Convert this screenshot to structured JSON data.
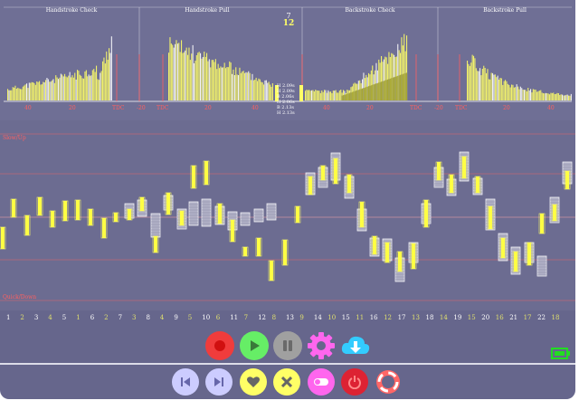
{
  "sections": [
    {
      "label": "Handstroke Check"
    },
    {
      "label": "Handstroke Pull"
    },
    {
      "label": "Backstroke Check"
    },
    {
      "label": "Backstroke Pull"
    }
  ],
  "counter": {
    "top": "7",
    "bottom": "12"
  },
  "mid_panel": {
    "lines": [
      "H 2.09s",
      "H 2.09s",
      "B 2.06s",
      "H 2.06s",
      "B 2.13s",
      "H 2.13s"
    ]
  },
  "axis_ticks": {
    "hs_check": [
      "40",
      "20",
      "TDC"
    ],
    "hs_pull": [
      "-20",
      "TDC",
      "20",
      "40"
    ],
    "bs_check": [
      "40",
      "20",
      "TDC"
    ],
    "bs_pull": [
      "-20",
      "TDC",
      "20",
      "40"
    ]
  },
  "graph_labels": {
    "slow": "Slow/Up",
    "quick": "Quick/Down"
  },
  "bells": [
    "1",
    "2",
    "3",
    "4",
    "5",
    "1",
    "6",
    "2",
    "7",
    "3",
    "8",
    "4",
    "9",
    "5",
    "10",
    "6",
    "11",
    "7",
    "12",
    "8",
    "13",
    "9",
    "14",
    "10",
    "15",
    "11",
    "16",
    "12",
    "17",
    "13",
    "18",
    "14",
    "19",
    "15",
    "20",
    "16",
    "21",
    "17",
    "22",
    "18"
  ],
  "colors": {
    "accent": "#ffff66",
    "grid": "#ff6060",
    "bg": "#66668c",
    "record": "#f03c3c",
    "play": "#66ee66",
    "pause": "#a0a0a0",
    "settings": "#ff66ee",
    "download": "#33ccff",
    "nav": "#ccccff",
    "heart": "#ffff66",
    "close": "#ffff66",
    "toggle": "#ff66ee",
    "power": "#dd2233",
    "help": "#ff6666"
  },
  "controls": {
    "record": "record-icon",
    "play": "play-icon",
    "pause": "pause-icon",
    "settings": "gear-icon",
    "download": "cloud-download-icon",
    "prev": "skip-back-icon",
    "next": "skip-forward-icon",
    "favorite": "heart-icon",
    "clear": "close-icon",
    "toggle": "toggle-icon",
    "power": "power-icon",
    "help": "lifebuoy-icon"
  },
  "battery": "battery-icon"
}
